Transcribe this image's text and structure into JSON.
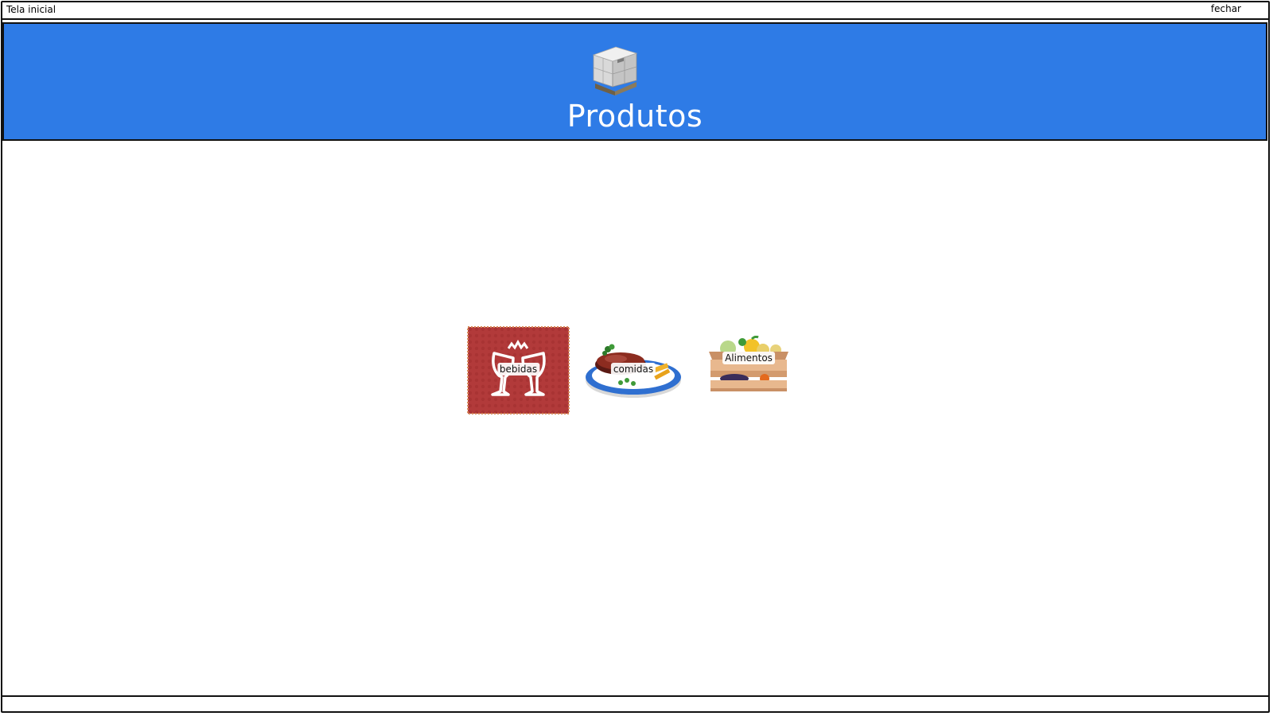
{
  "window": {
    "title": "Tela inicial",
    "close_label": "fechar"
  },
  "header": {
    "title": "Produtos",
    "icon": "boxes-pallet-icon",
    "background_color": "#2e7be6"
  },
  "categories": [
    {
      "label": "bebidas",
      "icon": "wine-glasses-toast-icon",
      "color": "#b33a3a"
    },
    {
      "label": "comidas",
      "icon": "steak-plate-icon"
    },
    {
      "label": "Alimentos",
      "icon": "vegetable-crate-icon"
    }
  ]
}
